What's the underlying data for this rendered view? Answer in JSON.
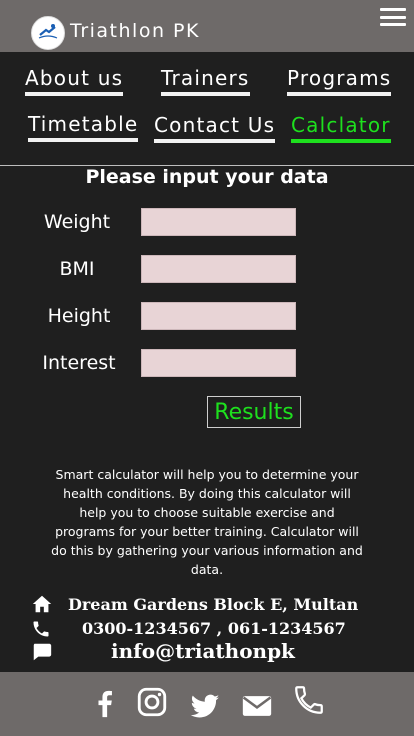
{
  "header": {
    "brand": "Triathlon PK",
    "logo_icon": "triathlon-logo-icon",
    "menu_icon": "hamburger-menu-icon"
  },
  "nav": {
    "about": "About us",
    "trainers": "Trainers",
    "programs": "Programs",
    "timetable": "Timetable",
    "contact": "Contact Us",
    "calculator": "Calclator"
  },
  "form": {
    "title": "Please input your data",
    "weight_label": "Weight",
    "bmi_label": "BMI",
    "height_label": "Height",
    "interest_label": "Interest",
    "weight_value": "",
    "bmi_value": "",
    "height_value": "",
    "interest_value": "",
    "results_label": "Results"
  },
  "description": "Smart calculator will help you to determine your health conditions. By doing this calculator will help you to choose suitable exercise and programs for your better training. Calculator will do this by gathering your various information and data.",
  "contact": {
    "address": "Dream Gardens Block E, Multan",
    "phones": "0300-1234567 , 061-1234567",
    "email": "info@triathonpk"
  },
  "footer": {
    "icons": [
      "facebook-icon",
      "instagram-icon",
      "twitter-icon",
      "mail-icon",
      "phone-icon"
    ]
  },
  "colors": {
    "header_bg": "#6e6a69",
    "page_bg": "#1f1f1f",
    "accent_green": "#1ee01e",
    "input_bg": "#e8d4d6"
  }
}
